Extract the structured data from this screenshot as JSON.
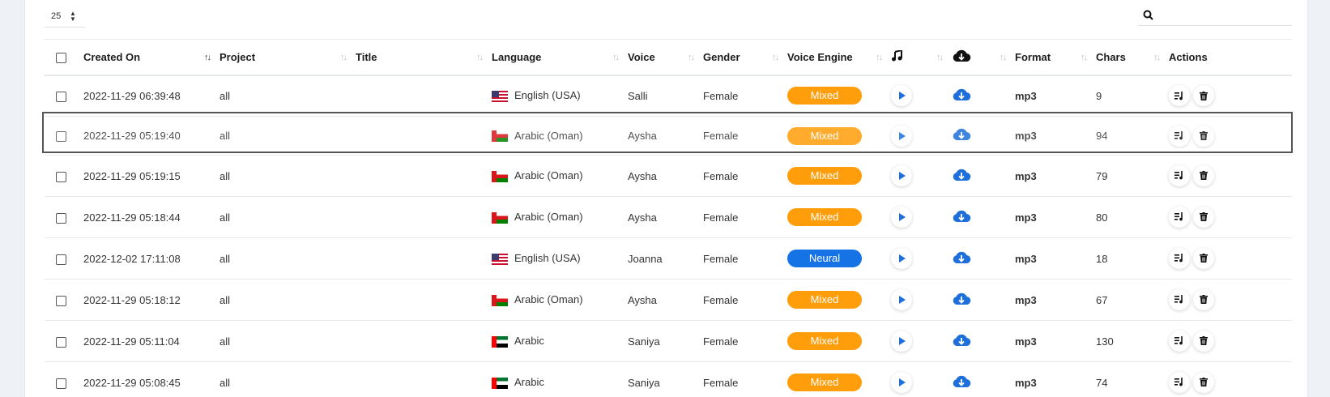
{
  "page_size": "25",
  "colors": {
    "mixed": "#ff9d0a",
    "neural": "#1673e6",
    "icon_blue": "#1e6fd9"
  },
  "columns": [
    {
      "label": "Created On",
      "sort": "active"
    },
    {
      "label": "Project",
      "sort": "none"
    },
    {
      "label": "Title",
      "sort": "none"
    },
    {
      "label": "Language",
      "sort": "none"
    },
    {
      "label": "Voice",
      "sort": "none"
    },
    {
      "label": "Gender",
      "sort": "none"
    },
    {
      "label": "Voice Engine",
      "sort": "none"
    },
    {
      "label": "",
      "icon": "music-note-icon",
      "sort": "none"
    },
    {
      "label": "",
      "icon": "cloud-download-icon",
      "sort": "none"
    },
    {
      "label": "Format",
      "sort": "none"
    },
    {
      "label": "Chars",
      "sort": "none"
    },
    {
      "label": "Actions",
      "sort": "none"
    }
  ],
  "rows": [
    {
      "created": "2022-11-29 06:39:48",
      "project": "all",
      "title": "",
      "flag": "us",
      "language": "English (USA)",
      "voice": "Salli",
      "gender": "Female",
      "engine": "Mixed",
      "format": "mp3",
      "chars": "9"
    },
    {
      "created": "2022-11-29 05:19:40",
      "project": "all",
      "title": "",
      "flag": "om",
      "language": "Arabic (Oman)",
      "voice": "Aysha",
      "gender": "Female",
      "engine": "Mixed",
      "format": "mp3",
      "chars": "94",
      "dragging": true
    },
    {
      "created": "2022-11-29 05:19:15",
      "project": "all",
      "title": "",
      "flag": "om",
      "language": "Arabic (Oman)",
      "voice": "Aysha",
      "gender": "Female",
      "engine": "Mixed",
      "format": "mp3",
      "chars": "79"
    },
    {
      "created": "2022-11-29 05:18:44",
      "project": "all",
      "title": "",
      "flag": "om",
      "language": "Arabic (Oman)",
      "voice": "Aysha",
      "gender": "Female",
      "engine": "Mixed",
      "format": "mp3",
      "chars": "80"
    },
    {
      "created": "2022-12-02 17:11:08",
      "project": "all",
      "title": "",
      "flag": "us",
      "language": "English (USA)",
      "voice": "Joanna",
      "gender": "Female",
      "engine": "Neural",
      "format": "mp3",
      "chars": "18"
    },
    {
      "created": "2022-11-29 05:18:12",
      "project": "all",
      "title": "",
      "flag": "om",
      "language": "Arabic (Oman)",
      "voice": "Aysha",
      "gender": "Female",
      "engine": "Mixed",
      "format": "mp3",
      "chars": "67"
    },
    {
      "created": "2022-11-29 05:11:04",
      "project": "all",
      "title": "",
      "flag": "ae",
      "language": "Arabic",
      "voice": "Saniya",
      "gender": "Female",
      "engine": "Mixed",
      "format": "mp3",
      "chars": "130"
    },
    {
      "created": "2022-11-29 05:08:45",
      "project": "all",
      "title": "",
      "flag": "ae",
      "language": "Arabic",
      "voice": "Saniya",
      "gender": "Female",
      "engine": "Mixed",
      "format": "mp3",
      "chars": "74"
    }
  ]
}
